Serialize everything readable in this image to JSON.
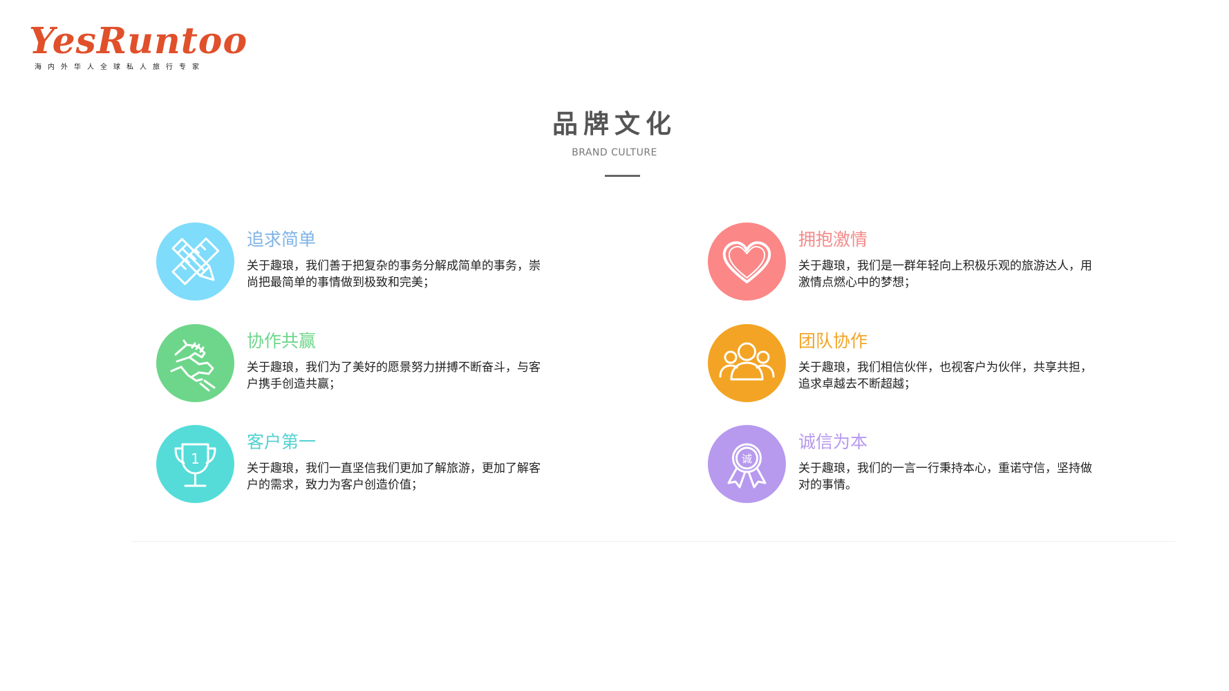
{
  "brand": {
    "logo_text": "YesRuntoo",
    "tagline": "海内外华人全球私人旅行专家",
    "logo_color": "#e0502b"
  },
  "section": {
    "title": "品牌文化",
    "subtitle": "BRAND CULTURE"
  },
  "features": [
    {
      "title": "追求简单",
      "description": "关于趣琅，我们善于把复杂的事务分解成简单的事务，崇尚把最简单的事情做到极致和完美；",
      "icon": "pencil-ruler-icon",
      "circle_color": "#7fdcfb",
      "title_color": "#7fb3e6"
    },
    {
      "title": "拥抱激情",
      "description": "关于趣琅，我们是一群年轻向上积极乐观的旅游达人，用激情点燃心中的梦想；",
      "icon": "heart-icon",
      "circle_color": "#fb8787",
      "title_color": "#f48a8a"
    },
    {
      "title": "协作共赢",
      "description": "关于趣琅，我们为了美好的愿景努力拼搏不断奋斗，与客户携手创造共赢；",
      "icon": "handshake-icon",
      "circle_color": "#6dd68a",
      "title_color": "#6dd68a"
    },
    {
      "title": "团队协作",
      "description": "关于趣琅，我们相信伙伴，也视客户为伙伴，共享共担，追求卓越去不断超越；",
      "icon": "team-icon",
      "circle_color": "#f3a424",
      "title_color": "#f3a424"
    },
    {
      "title": "客户第一",
      "description": "关于趣琅，我们一直坚信我们更加了解旅游，更加了解客户的需求，致力为客户创造价值；",
      "icon": "trophy-icon",
      "circle_color": "#55dcd9",
      "title_color": "#55d1d2"
    },
    {
      "title": "诚信为本",
      "description": "关于趣琅，我们的一言一行秉持本心，重诺守信，坚持做对的事情。",
      "icon": "integrity-badge-icon",
      "circle_color": "#b799ee",
      "title_color": "#b799ee",
      "badge_text": "诚"
    }
  ]
}
